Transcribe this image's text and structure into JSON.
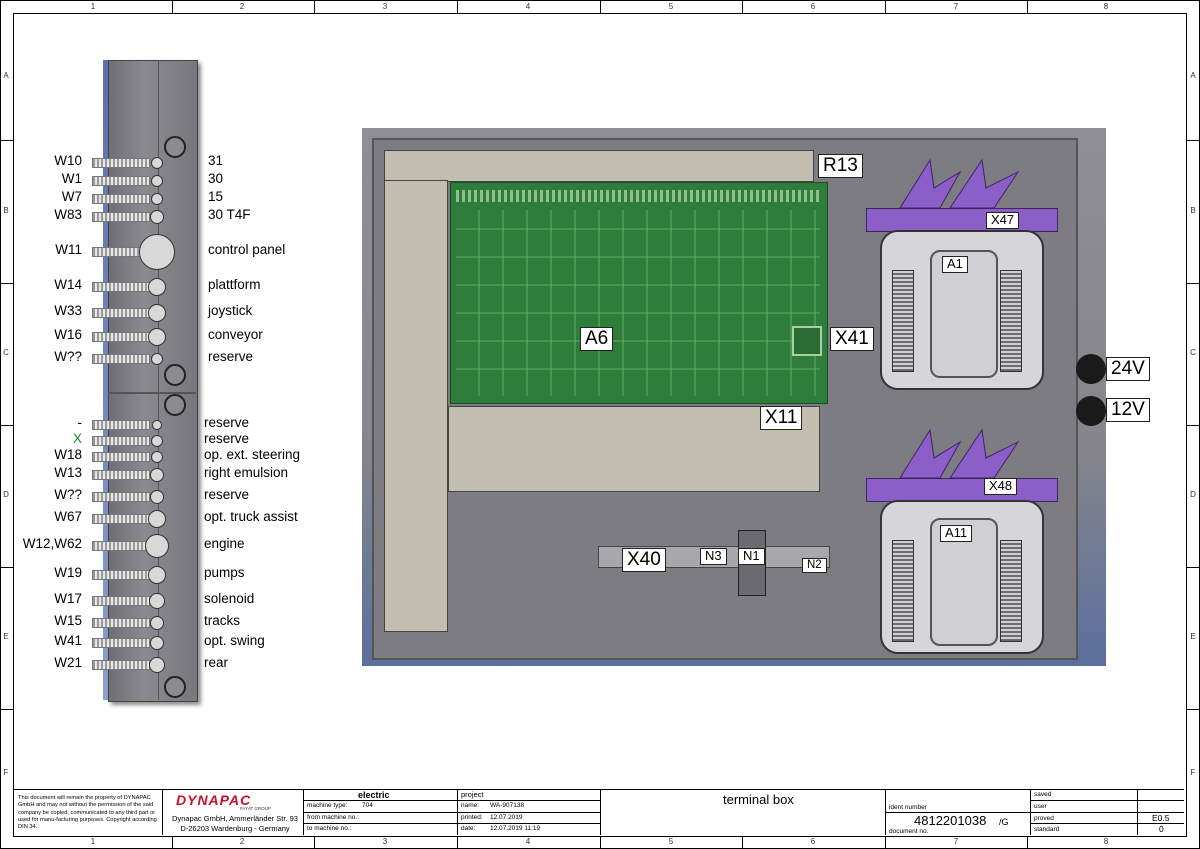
{
  "zones": {
    "columns": [
      "1",
      "2",
      "3",
      "4",
      "5",
      "6",
      "7",
      "8"
    ],
    "rows": [
      "A",
      "B",
      "C",
      "D",
      "E",
      "F"
    ]
  },
  "left_strip": {
    "wires": [
      "W10",
      "W1",
      "W7",
      "W83",
      "W11",
      "W14",
      "W33",
      "W16",
      "W??",
      "-",
      "X",
      "W18",
      "W13",
      "W??",
      "W67",
      "W12,W62",
      "W19",
      "W17",
      "W15",
      "W41",
      "W21"
    ],
    "descriptions": [
      "31",
      "30",
      "15",
      "30 T4F",
      "control panel",
      "plattform",
      "joystick",
      "conveyor",
      "reserve",
      "reserve",
      "reserve",
      "op. ext. steering",
      "right emulsion",
      "reserve",
      "opt. truck assist",
      "engine",
      "pumps",
      "solenoid",
      "tracks",
      "opt. swing",
      "rear"
    ],
    "x_color": "#1a8a1a"
  },
  "components": {
    "R13": "R13",
    "A6": "A6",
    "X41": "X41",
    "X11": "X11",
    "X47": "X47",
    "A1": "A1",
    "X48": "X48",
    "A11": "A11",
    "X40": "X40",
    "N3": "N3",
    "N1": "N1",
    "N2": "N2",
    "V24": "24V",
    "V12": "12V"
  },
  "colors": {
    "pcb": "#2e7d3a",
    "bracket": "#8c5ec7",
    "rail": "#c3bfb0",
    "logo": "#c8102e"
  },
  "title_block": {
    "legal": "This document will remain the property of DYNAPAC GmbH and may not without the permission of the said company be copied, communicated to any third part or used for manu-facturing purposes. Copyright according DIN 34.",
    "company": "DYNAPAC",
    "company_sub": "FAYAT GROUP",
    "address_1": "Dynapac GmbH, Ammerländer Str. 93",
    "address_2": "D-26203 Wardenburg - Germany",
    "section": "electric",
    "machine_type_label": "machine type:",
    "machine_type": "704",
    "from_machine_label": "from machine no.:",
    "to_machine_label": "to machine no.:",
    "project_label": "project",
    "name_label": "name:",
    "name": "WA-907138",
    "printed_label": "printed:",
    "printed": "12.07.2019",
    "date_label": "date:",
    "date": "12.07.2019  11:19",
    "title": "terminal box",
    "ident_label": "ident number",
    "ident": "4812201038",
    "revision": "/G",
    "doc_label": "document no.",
    "saved_label": "saved",
    "user_label": "user",
    "proved_label": "proved",
    "standard_label": "standard",
    "sheet": "E0.5",
    "sheet_no": "0"
  }
}
